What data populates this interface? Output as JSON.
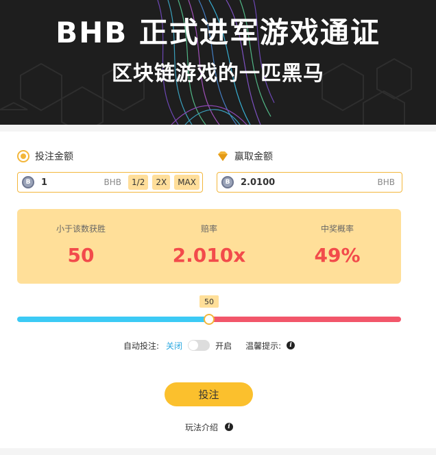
{
  "banner": {
    "title": "BHB 正式进军游戏通证",
    "subtitle": "区块链游戏的一匹黑马"
  },
  "bet": {
    "label": "投注金额",
    "icon": "coin-target-icon",
    "value": "1",
    "unit": "BHB",
    "buttons": [
      "1/2",
      "2X",
      "MAX"
    ]
  },
  "win": {
    "label": "赢取金额",
    "icon": "diamond-icon",
    "value": "2.0100",
    "unit": "BHB"
  },
  "stats": [
    {
      "label": "小于该数获胜",
      "value": "50"
    },
    {
      "label": "赔率",
      "value": "2.010x"
    },
    {
      "label": "中奖概率",
      "value": "49%"
    }
  ],
  "slider": {
    "value": "50",
    "position_percent": 50,
    "left_color": "#3ccaf5",
    "right_color": "#f2566a"
  },
  "auto": {
    "label": "自动投注:",
    "off_label": "关闭",
    "on_label": "开启",
    "tips_label": "温馨提示:"
  },
  "action": {
    "bet_button": "投注",
    "howto_label": "玩法介绍"
  },
  "colors": {
    "accent": "#fbc02d",
    "stats_bg": "#ffdf99",
    "highlight": "#f24b4b"
  }
}
